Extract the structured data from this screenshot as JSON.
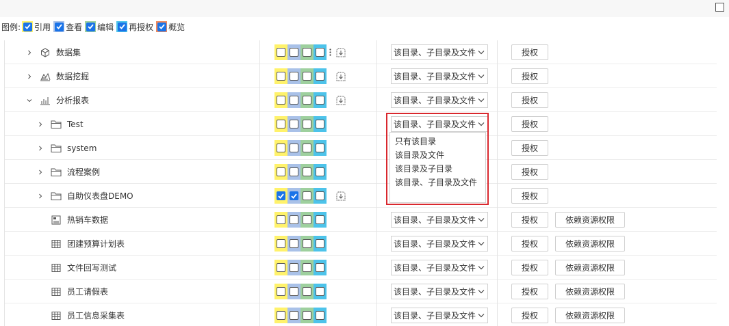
{
  "legend": {
    "label": "图例:",
    "items": [
      {
        "key": "cite",
        "label": "引用",
        "color": "#fff26b"
      },
      {
        "key": "view",
        "label": "查看",
        "color": "#a9c1e8"
      },
      {
        "key": "edit",
        "label": "编辑",
        "color": "#9ed09e"
      },
      {
        "key": "regrant",
        "label": "再授权",
        "color": "#4dc3ea"
      },
      {
        "key": "overview",
        "label": "概览",
        "color": "#f08a5d"
      }
    ]
  },
  "perm_colors": [
    "#fff26b",
    "#a9c1e8",
    "#9ed09e",
    "#4dc3ea"
  ],
  "rows": [
    {
      "name": "数据集",
      "icon": "cube-icon",
      "expand": "collapsed",
      "indent": 1,
      "checks": [
        false,
        false,
        false,
        false
      ],
      "dots": true,
      "inherit": true,
      "select": "该目录、子目录及文件",
      "grant": "授权",
      "dep": ""
    },
    {
      "name": "数据挖掘",
      "icon": "mining-icon",
      "expand": "collapsed",
      "indent": 1,
      "checks": [
        false,
        false,
        false,
        false
      ],
      "dots": false,
      "inherit": true,
      "select": "该目录、子目录及文件",
      "grant": "授权",
      "dep": ""
    },
    {
      "name": "分析报表",
      "icon": "chart-icon",
      "expand": "expanded",
      "indent": 1,
      "checks": [
        false,
        false,
        false,
        false
      ],
      "dots": false,
      "inherit": true,
      "select": "该目录、子目录及文件",
      "grant": "授权",
      "dep": ""
    },
    {
      "name": "Test",
      "icon": "folder-icon",
      "expand": "collapsed",
      "indent": 2,
      "checks": [
        false,
        false,
        false,
        false
      ],
      "dots": false,
      "inherit": false,
      "select": "该目录、子目录及文件",
      "grant": "授权",
      "dep": ""
    },
    {
      "name": "system",
      "icon": "folder-icon",
      "expand": "collapsed",
      "indent": 2,
      "checks": [
        false,
        false,
        false,
        false
      ],
      "dots": false,
      "inherit": false,
      "select": "",
      "grant": "授权",
      "dep": ""
    },
    {
      "name": "流程案例",
      "icon": "folder-icon",
      "expand": "collapsed",
      "indent": 2,
      "checks": [
        false,
        false,
        false,
        false
      ],
      "dots": false,
      "inherit": false,
      "select": "",
      "grant": "授权",
      "dep": ""
    },
    {
      "name": "自助仪表盘DEMO",
      "icon": "folder-icon",
      "expand": "collapsed",
      "indent": 2,
      "checks": [
        true,
        true,
        false,
        false
      ],
      "dots": false,
      "inherit": true,
      "select": "",
      "grant": "授权",
      "dep": ""
    },
    {
      "name": "热销车数据",
      "icon": "dashboard-icon",
      "expand": "none",
      "indent": 2,
      "checks": [
        false,
        false,
        false,
        false
      ],
      "dots": false,
      "inherit": false,
      "select": "该目录、子目录及文件",
      "grant": "授权",
      "dep": "依赖资源权限"
    },
    {
      "name": "团建预算计划表",
      "icon": "table-icon",
      "expand": "none",
      "indent": 2,
      "checks": [
        false,
        false,
        false,
        false
      ],
      "dots": false,
      "inherit": false,
      "select": "该目录、子目录及文件",
      "grant": "授权",
      "dep": "依赖资源权限"
    },
    {
      "name": "文件回写测试",
      "icon": "table-icon",
      "expand": "none",
      "indent": 2,
      "checks": [
        false,
        false,
        false,
        false
      ],
      "dots": false,
      "inherit": false,
      "select": "该目录、子目录及文件",
      "grant": "授权",
      "dep": "依赖资源权限"
    },
    {
      "name": "员工请假表",
      "icon": "table-icon",
      "expand": "none",
      "indent": 2,
      "checks": [
        false,
        false,
        false,
        false
      ],
      "dots": false,
      "inherit": false,
      "select": "该目录、子目录及文件",
      "grant": "授权",
      "dep": "依赖资源权限"
    },
    {
      "name": "员工信息采集表",
      "icon": "table-icon",
      "expand": "none",
      "indent": 2,
      "checks": [
        false,
        false,
        false,
        false
      ],
      "dots": false,
      "inherit": false,
      "select": "该目录、子目录及文件",
      "grant": "授权",
      "dep": "依赖资源权限"
    }
  ],
  "dropdown": {
    "options": [
      "只有该目录",
      "该目录及文件",
      "该目录及子目录",
      "该目录、子目录及文件"
    ]
  }
}
